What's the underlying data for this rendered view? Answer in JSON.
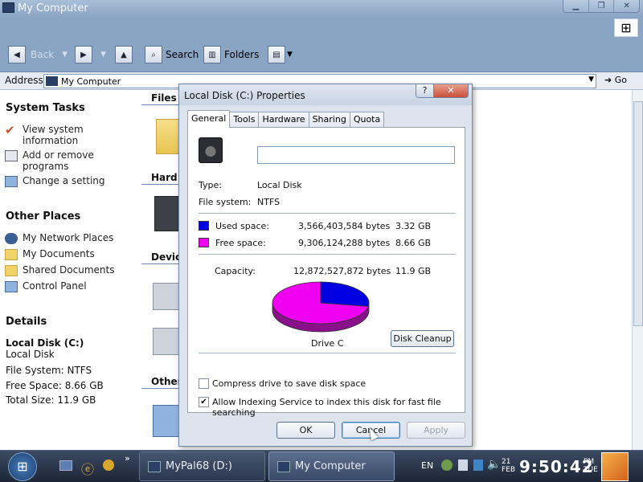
{
  "window": {
    "title": "My Computer",
    "controls": [
      "minimize",
      "restore",
      "close"
    ]
  },
  "toolbar": {
    "back_label": "Back",
    "search_label": "Search",
    "folders_label": "Folders"
  },
  "address": {
    "label": "Address",
    "value": "My Computer",
    "go_label": "Go"
  },
  "sidebar": {
    "system_tasks": {
      "title": "System Tasks",
      "items": [
        {
          "label": "View system information",
          "icon": "check-icon"
        },
        {
          "label": "Add or remove programs",
          "icon": "programs-icon"
        },
        {
          "label": "Change a setting",
          "icon": "control-icon"
        }
      ]
    },
    "other_places": {
      "title": "Other Places",
      "items": [
        {
          "label": "My Network Places",
          "icon": "network-icon"
        },
        {
          "label": "My Documents",
          "icon": "folder-icon"
        },
        {
          "label": "Shared Documents",
          "icon": "folder-icon"
        },
        {
          "label": "Control Panel",
          "icon": "control-icon"
        }
      ]
    },
    "details": {
      "title": "Details",
      "name": "Local Disk (C:)",
      "type": "Local Disk",
      "file_system": "File System: NTFS",
      "free_space": "Free Space: 8.66 GB",
      "total_size": "Total Size: 11.9 GB"
    }
  },
  "content": {
    "sections": [
      "Files S",
      "Hard D",
      "Device",
      "Other"
    ]
  },
  "dialog": {
    "title": "Local Disk (C:) Properties",
    "help": "?",
    "tabs": [
      "General",
      "Tools",
      "Hardware",
      "Sharing",
      "Quota"
    ],
    "active_tab": "General",
    "name_value": "",
    "type_label": "Type:",
    "type_value": "Local Disk",
    "fs_label": "File system:",
    "fs_value": "NTFS",
    "used_label": "Used space:",
    "used_bytes": "3,566,403,584 bytes",
    "used_gb": "3.32 GB",
    "used_color": "#0000e0",
    "free_label": "Free space:",
    "free_bytes": "9,306,124,288 bytes",
    "free_gb": "8.66 GB",
    "free_color": "#f000f0",
    "capacity_label": "Capacity:",
    "capacity_bytes": "12,872,527,872 bytes",
    "capacity_gb": "11.9 GB",
    "used_fraction": 0.277,
    "drive_label": "Drive C",
    "cleanup_label": "Disk Cleanup",
    "compress_label": "Compress drive to save disk space",
    "compress_checked": false,
    "index_label": "Allow Indexing Service to index this disk for fast file searching",
    "index_checked": true,
    "ok_label": "OK",
    "cancel_label": "Cancel",
    "apply_label": "Apply"
  },
  "taskbar": {
    "tasks": [
      {
        "label": "MyPal68 (D:)",
        "active": false
      },
      {
        "label": "My Computer",
        "active": true
      }
    ],
    "lang": "EN",
    "date_day": "21",
    "date_month": "FEB",
    "time": "9:50:42",
    "ampm": "PM",
    "weekday": "TUE"
  }
}
